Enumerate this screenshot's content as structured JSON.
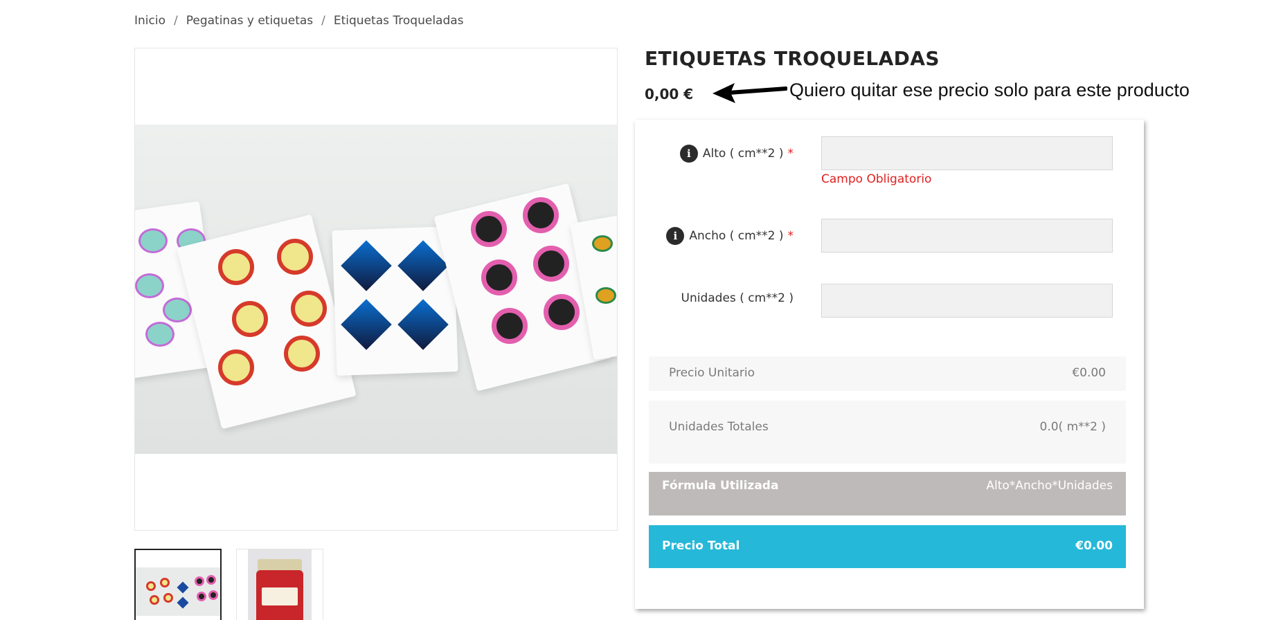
{
  "breadcrumb": {
    "items": [
      "Inicio",
      "Pegatinas y etiquetas",
      "Etiquetas Troqueladas"
    ],
    "separator": "/"
  },
  "product": {
    "title": "ETIQUETAS TROQUELADAS",
    "price": "0,00 €"
  },
  "annotation": {
    "text": "Quiero quitar ese precio solo para este producto"
  },
  "form": {
    "fields": [
      {
        "label": "Alto ( cm**2 )",
        "required_mark": "*",
        "info_icon": "info-icon",
        "value": "",
        "error": "Campo Obligatorio"
      },
      {
        "label": "Ancho ( cm**2 )",
        "required_mark": "*",
        "info_icon": "info-icon",
        "value": ""
      },
      {
        "label": "Unidades ( cm**2 )",
        "value": ""
      }
    ],
    "unit_price": {
      "label": "Precio Unitario",
      "value": "€0.00"
    },
    "total_units": {
      "label": "Unidades Totales",
      "value": "0.0( m**2 )"
    },
    "formula": {
      "label": "Fórmula Utilizada",
      "value": "Alto*Ancho*Unidades"
    },
    "total_price": {
      "label": "Precio Total",
      "value": "€0.00"
    }
  },
  "colors": {
    "accent_total": "#26b8d8",
    "formula_bg": "#bfbaba",
    "error": "#e02020"
  }
}
